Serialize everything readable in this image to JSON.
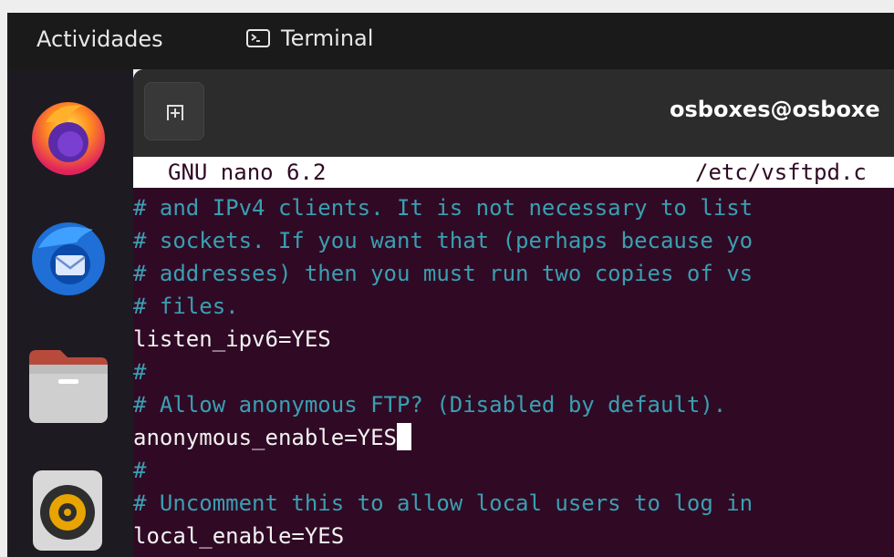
{
  "topbar": {
    "activities_label": "Actividades",
    "app_name": "Terminal"
  },
  "dock": {
    "apps": [
      "firefox-icon",
      "thunderbird-icon",
      "files-icon",
      "rhythmbox-icon"
    ]
  },
  "window": {
    "title": "osboxes@osboxe"
  },
  "nano": {
    "version": "GNU nano 6.2",
    "filename": "/etc/vsftpd.c"
  },
  "editor": {
    "lines": [
      {
        "text": "# and IPv4 clients. It is not necessary to list",
        "kind": "comment"
      },
      {
        "text": "# sockets. If you want that (perhaps because yo",
        "kind": "comment"
      },
      {
        "text": "# addresses) then you must run two copies of vs",
        "kind": "comment"
      },
      {
        "text": "# files.",
        "kind": "comment"
      },
      {
        "text": "listen_ipv6=YES",
        "kind": "setting"
      },
      {
        "text": "#",
        "kind": "comment"
      },
      {
        "text": "# Allow anonymous FTP? (Disabled by default).",
        "kind": "comment"
      },
      {
        "text": "anonymous_enable=YES",
        "kind": "setting"
      },
      {
        "text": "#",
        "kind": "comment"
      },
      {
        "text": "# Uncomment this to allow local users to log in",
        "kind": "comment"
      },
      {
        "text": "local_enable=YES",
        "kind": "setting"
      }
    ],
    "cursor_line": 7
  },
  "colors": {
    "terminal_bg": "#300a24",
    "comment": "#3a9fb3",
    "text": "#f2f2f2"
  }
}
